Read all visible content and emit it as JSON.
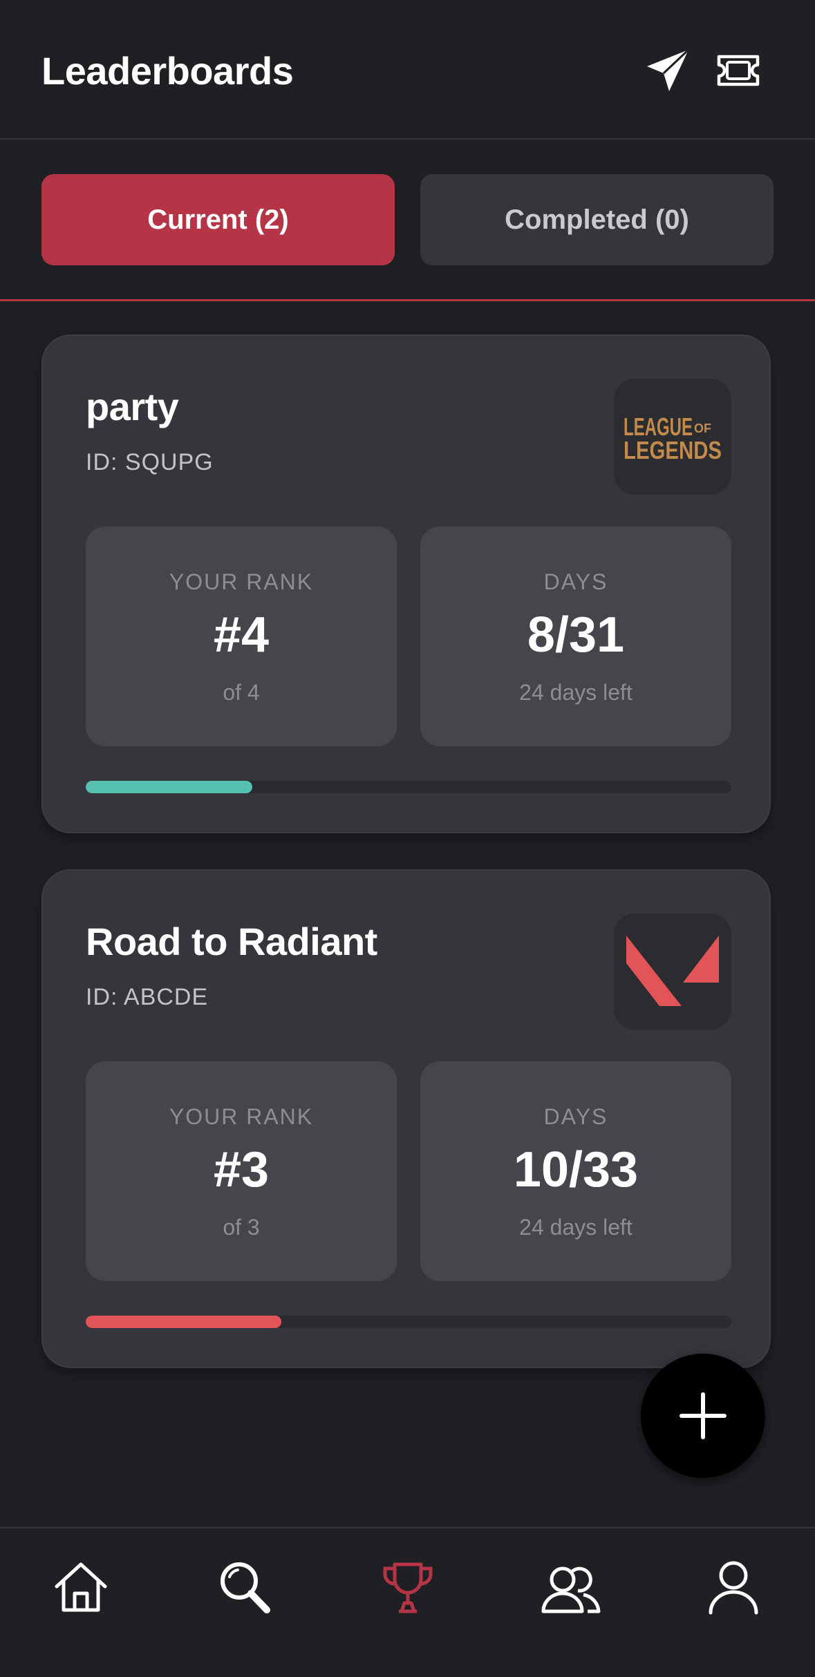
{
  "header": {
    "title": "Leaderboards"
  },
  "tabs": [
    {
      "label": "Current (2)",
      "active": true
    },
    {
      "label": "Completed (0)",
      "active": false
    }
  ],
  "leaderboards": [
    {
      "name": "party",
      "id_text": "ID: SQUPG",
      "game_logo": "league-of-legends-logo",
      "logo_text": [
        "LEAGUE",
        "OF",
        "LEGENDS"
      ],
      "rank_label": "YOUR RANK",
      "rank_value": "#4",
      "rank_sub": "of 4",
      "days_label": "DAYS",
      "days_value": "8/31",
      "days_sub": "24 days left",
      "progress": 0.258,
      "progress_color": "#55c1b0"
    },
    {
      "name": "Road to Radiant",
      "id_text": "ID: ABCDE",
      "game_logo": "valorant-logo",
      "rank_label": "YOUR RANK",
      "rank_value": "#3",
      "rank_sub": "of 3",
      "days_label": "DAYS",
      "days_value": "10/33",
      "days_sub": "24 days left",
      "progress": 0.303,
      "progress_color": "#e35459"
    }
  ],
  "colors": {
    "accent": "#b53546",
    "background": "#1f2024",
    "card": "#35363b",
    "active_nav": "#b53546"
  },
  "bottom_nav": [
    {
      "icon": "home-icon",
      "active": false
    },
    {
      "icon": "search-icon",
      "active": false
    },
    {
      "icon": "trophy-icon",
      "active": true
    },
    {
      "icon": "friends-icon",
      "active": false
    },
    {
      "icon": "profile-icon",
      "active": false
    }
  ]
}
